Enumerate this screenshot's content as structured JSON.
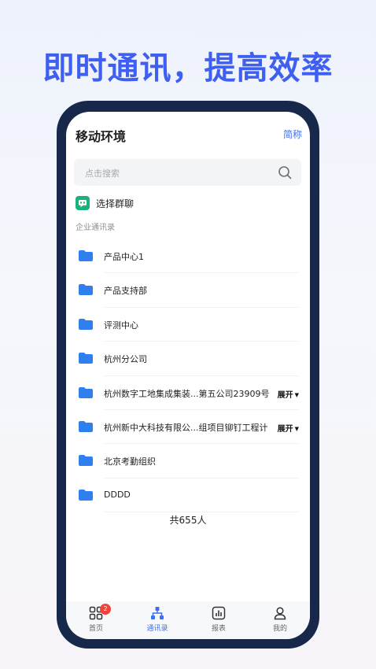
{
  "headline": "即时通讯，提高效率",
  "header": {
    "title": "移动环境",
    "short_name_link": "简称"
  },
  "search": {
    "placeholder": "点击搜索"
  },
  "select_group": {
    "label": "选择群聊"
  },
  "section_label": "企业通讯录",
  "departments": [
    {
      "name": "产品中心1"
    },
    {
      "name": "产品支持部"
    },
    {
      "name": "评测中心"
    },
    {
      "name": "杭州分公司"
    },
    {
      "name": "杭州数字工地集成集装...第五公司23909号",
      "expand": "展开"
    },
    {
      "name": "杭州新中大科技有限公...组项目铆钉工程计",
      "expand": "展开"
    },
    {
      "name": "北京考勤组织"
    },
    {
      "name": "DDDD"
    }
  ],
  "total": "共655人",
  "tabbar": {
    "items": [
      {
        "label": "首页",
        "badge": "2"
      },
      {
        "label": "通讯录"
      },
      {
        "label": "报表"
      },
      {
        "label": "我的"
      }
    ]
  },
  "colors": {
    "accent": "#3f6ff0",
    "headline": "#3f5ff0",
    "frame": "#17284a",
    "folder": "#2f7fef",
    "group_icon": "#19b27a",
    "badge": "#f0433a"
  }
}
